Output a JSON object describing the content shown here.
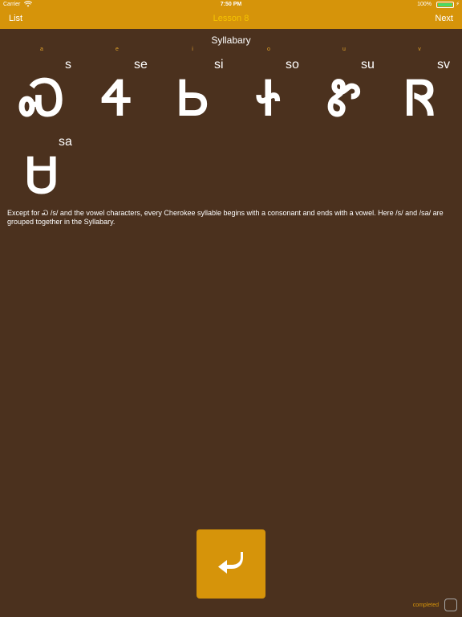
{
  "status_bar": {
    "carrier": "Carrier",
    "time": "7:50 PM",
    "battery": "100%"
  },
  "nav": {
    "left": "List",
    "title": "Lesson 8",
    "right": "Next"
  },
  "heading": "Syllabary",
  "vowels": [
    "a",
    "e",
    "i",
    "o",
    "u",
    "v"
  ],
  "syllables": [
    {
      "glyph": "Ꮝ",
      "roman": "s"
    },
    {
      "glyph": "Ꮞ",
      "roman": "se"
    },
    {
      "glyph": "Ꮟ",
      "roman": "si"
    },
    {
      "glyph": "Ꮠ",
      "roman": "so"
    },
    {
      "glyph": "Ꮡ",
      "roman": "su"
    },
    {
      "glyph": "Ꮢ",
      "roman": "sv"
    },
    {
      "glyph": "Ꮜ",
      "roman": "sa"
    }
  ],
  "description": "Except for Ꮝ /s/ and the vowel characters, every Cherokee syllable begins with a consonant and ends with a vowel. Here /s/ and /sa/ are grouped together in the Syllabary.",
  "completed_label": "completed",
  "colors": {
    "accent": "#d6940a",
    "background": "#4b311e",
    "title": "#f5c400"
  }
}
